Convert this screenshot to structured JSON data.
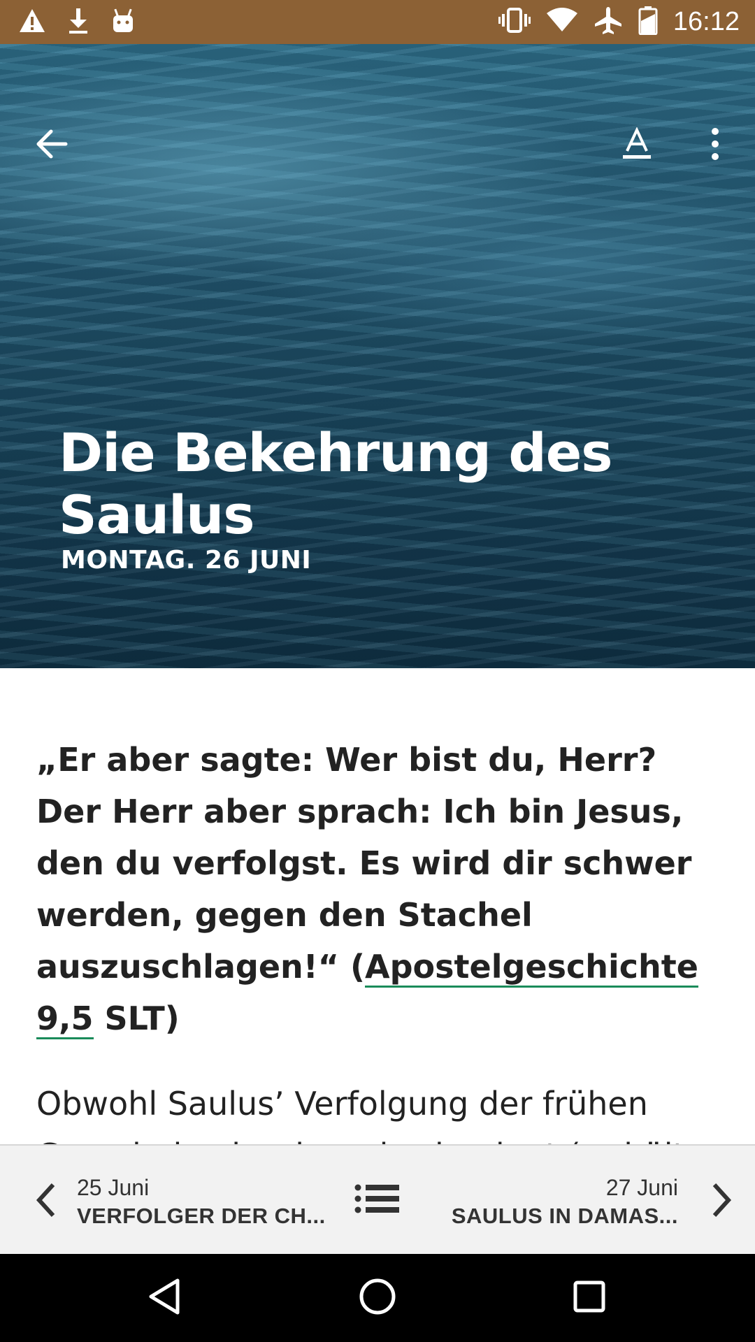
{
  "status_bar": {
    "time": "16:12",
    "background": "#8c6135",
    "left_icons": [
      "warning-icon",
      "download-icon",
      "android-icon"
    ],
    "right_icons": [
      "vibrate-icon",
      "wifi-icon",
      "airplane-icon",
      "battery-icon"
    ]
  },
  "header": {
    "back_icon": "arrow-back-icon",
    "font_icon": "font-size-icon",
    "more_icon": "more-vert-icon"
  },
  "hero": {
    "title": "Die Bekehrung des Saulus",
    "date": "MONTAG. 26 JUNI"
  },
  "content": {
    "quote_text": "„Er aber sagte: Wer bist du, Herr? Der Herr aber sprach: Ich bin Jesus, den du verfolgst. Es wird dir schwer werden, gegen den Stachel auszuschlagen!“ (",
    "quote_reference": "Apostelgeschichte 9,5",
    "quote_suffix": " SLT)",
    "link_color": "#1a8b5a",
    "body_text": "Obwohl Saulus’ Verfolgung der frühen Gemeinde eher harmlos beginnt (er hält nur"
  },
  "bottom_nav": {
    "prev": {
      "date": "25 Juni",
      "title": "VERFOLGER DER CH..."
    },
    "next": {
      "date": "27 Juni",
      "title": "SAULUS IN DAMAS..."
    },
    "list_icon": "list-icon"
  },
  "system_nav": [
    "back-triangle-icon",
    "home-circle-icon",
    "recents-square-icon"
  ]
}
